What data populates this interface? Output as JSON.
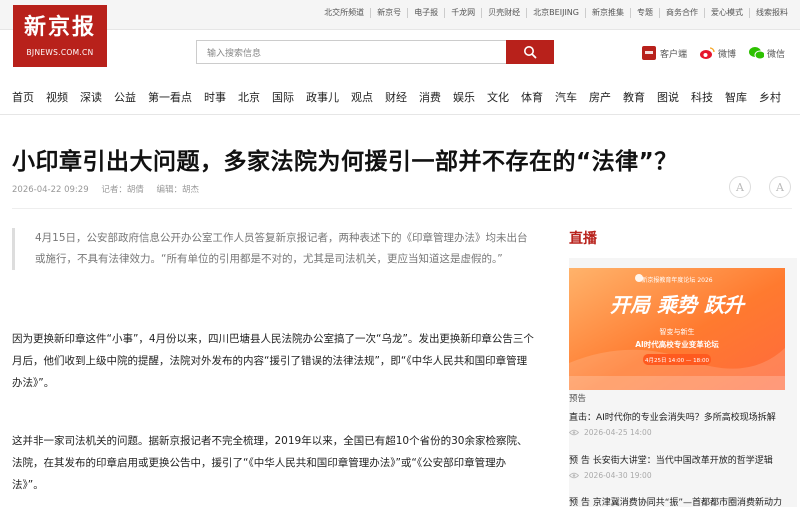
{
  "top_links": [
    "北交所频道",
    "新京号",
    "电子报",
    "千龙网",
    "贝壳财经",
    "北京BEIJING",
    "新京推集",
    "专题",
    "商务合作",
    "爱心模式",
    "线索报料"
  ],
  "logo": {
    "cn": "新京报",
    "en": "BJNEWS.COM.CN"
  },
  "search": {
    "placeholder": "输入搜索信息"
  },
  "shortcuts": {
    "client": "客户端",
    "weibo": "微博",
    "wechat": "微信"
  },
  "nav": [
    "首页",
    "视频",
    "深读",
    "公益",
    "第一看点",
    "时事",
    "北京",
    "国际",
    "政事儿",
    "观点",
    "财经",
    "消费",
    "娱乐",
    "文化",
    "体育",
    "汽车",
    "房产",
    "教育",
    "图说",
    "科技",
    "智库",
    "乡村"
  ],
  "article": {
    "title": "小印章引出大问题，多家法院为何援引一部并不存在的“法律”？",
    "date": "2026-04-22 09:29",
    "reporter": "记者：胡倩",
    "editor": "编辑：胡杰",
    "font_btn": "A",
    "quote": "4月15日，公安部政府信息公开办公室工作人员答复新京报记者，两种表述下的《印章管理办法》均未出台或施行，不具有法律效力。“所有单位的引用都是不对的，尤其是司法机关，更应当知道这是虚假的。”",
    "para1": "因为更换新印章这件“小事”，4月份以来，四川巴塘县人民法院办公室搞了一次“乌龙”。发出更换新印章公告三个月后，他们收到上级中院的提醒，法院对外发布的内容“援引了错误的法律法规”，即“《中华人民共和国印章管理办法》”。",
    "para2": "这并非一家司法机关的问题。据新京报记者不完全梳理，2019年以来，全国已有超10个省份的30余家检察院、法院，在其发布的印章启用或更换公告中，援引了“《中华人民共和国印章管理办法》”或“《公安部印章管理办法》”。"
  },
  "sidebar": {
    "title": "直播",
    "banner": {
      "top": "新京报教育年度论坛 2026",
      "slogan": "开局 乘势 跃升",
      "sub1": "智变与新生",
      "sub2": "AI时代高校专业变革论坛",
      "time": "4月25日 14:00 — 18:00"
    },
    "preview_label": "预告",
    "items": [
      {
        "title": "直击：AI时代你的专业会消失吗？多所高校现场拆解",
        "date": "2026-04-25 14:00"
      },
      {
        "title": "预 告 长安街大讲堂：当代中国改革开放的哲学逻辑",
        "date": "2026-04-30 19:00"
      },
      {
        "title": "预 告 京津冀消费协同共“振”—首都都市圈消费新动力",
        "date": ""
      }
    ]
  },
  "colors": {
    "brand": "#b8211b",
    "banner_bg": "#ff8a3d"
  }
}
